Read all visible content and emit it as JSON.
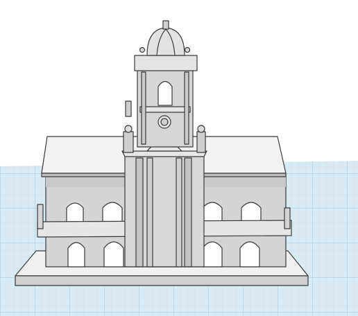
{
  "workspace": {
    "background_color": "#ffffff",
    "grid_plane_color": "#d9eaf2",
    "grid_minor_color": "#bfd9e6",
    "grid_major_color": "#9cc4d8"
  },
  "model": {
    "subject": "cabildo-building",
    "wall_color": "#d4d4d4",
    "wall_light_color": "#e6e6e6",
    "roof_color": "#f2f2f2",
    "shadow_color": "#bdbdbd",
    "outline_color": "#3a3a3a",
    "opening_color": "#ffffff"
  },
  "icons": {
    "model": "building-model"
  }
}
